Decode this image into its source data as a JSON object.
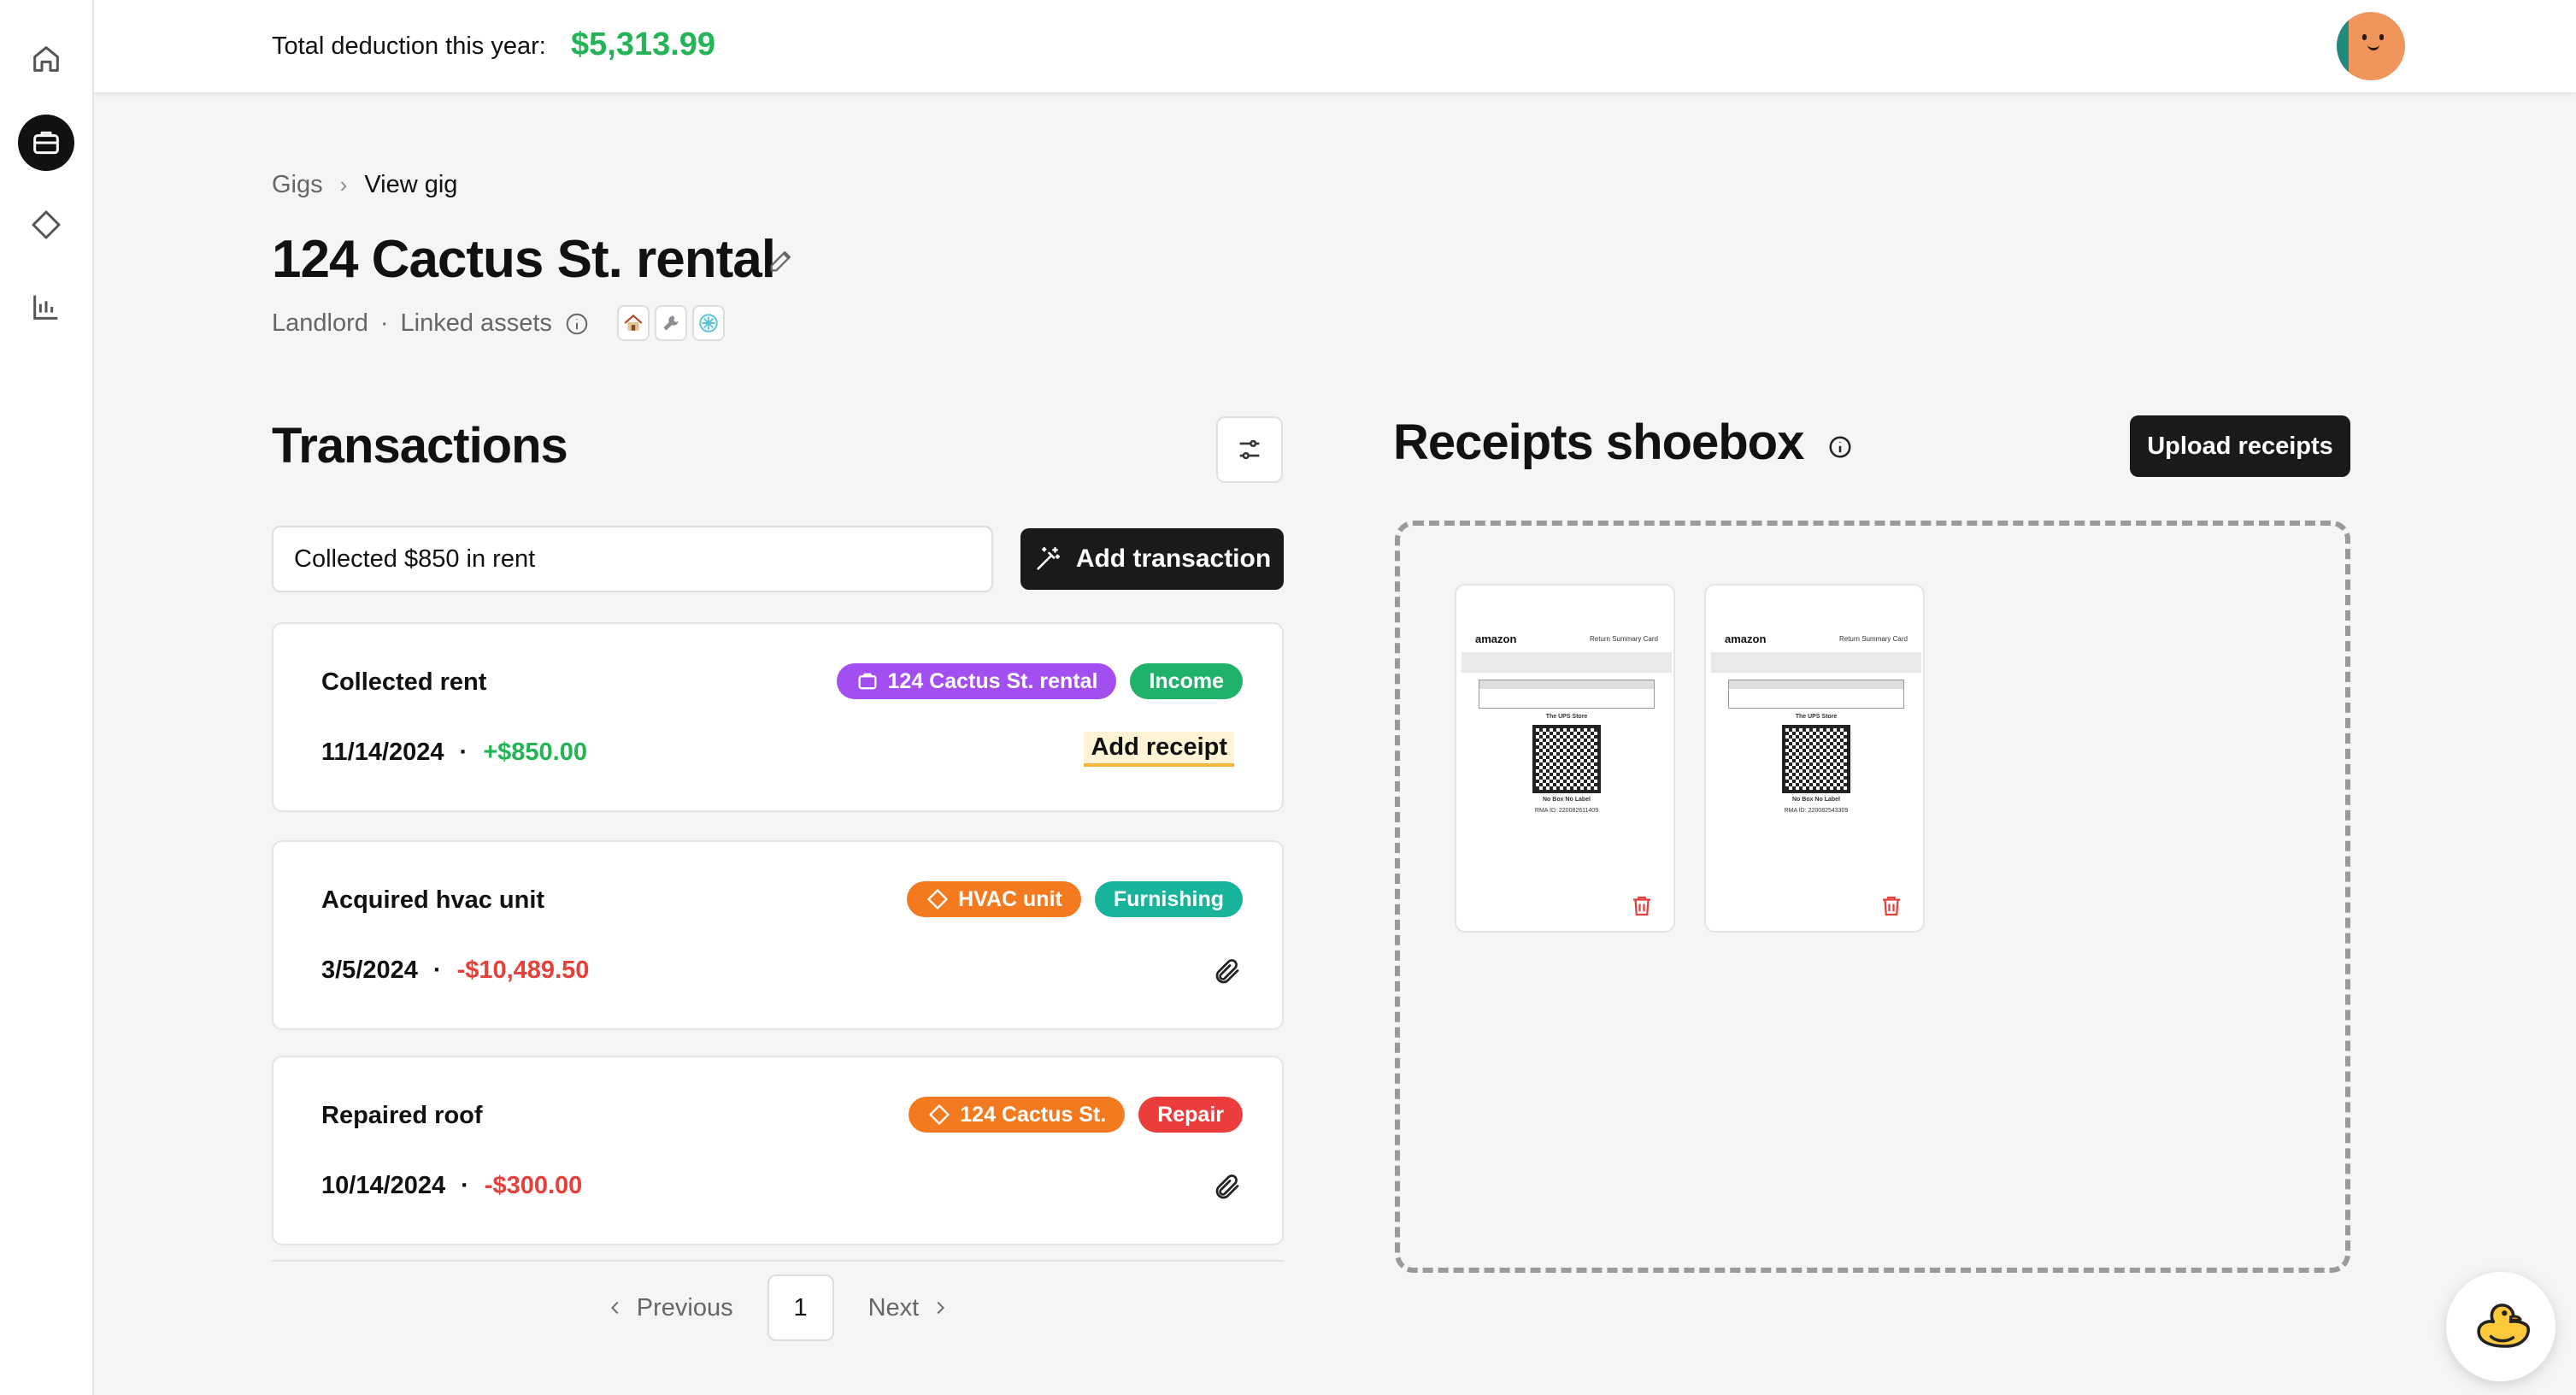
{
  "header": {
    "deduction_label": "Total deduction this year:",
    "deduction_value": "$5,313.99"
  },
  "sidebar": {
    "items": [
      {
        "icon": "home-icon",
        "active": false
      },
      {
        "icon": "briefcase-icon",
        "active": true
      },
      {
        "icon": "diamond-icon",
        "active": false
      },
      {
        "icon": "bar-chart-icon",
        "active": false
      }
    ]
  },
  "breadcrumb": {
    "parent": "Gigs",
    "separator": "›",
    "current": "View gig"
  },
  "gig": {
    "title": "124 Cactus St. rental",
    "role": "Landlord",
    "dot": "·",
    "linked_assets_label": "Linked assets",
    "asset_icons": [
      "house-icon",
      "wrench-icon",
      "snowflake-icon"
    ]
  },
  "transactions": {
    "title": "Transactions",
    "input_value": "Collected $850 in rent",
    "add_button": "Add transaction",
    "items": [
      {
        "name": "Collected rent",
        "date": "11/14/2024",
        "amount": "+$850.00",
        "amount_type": "positive",
        "tags": [
          {
            "label": "124 Cactus St. rental",
            "color": "#a24ef0",
            "icon": "briefcase-icon"
          },
          {
            "label": "Income",
            "color": "#20b26b"
          }
        ],
        "action": "Add receipt"
      },
      {
        "name": "Acquired hvac unit",
        "date": "3/5/2024",
        "amount": "-$10,489.50",
        "amount_type": "negative",
        "tags": [
          {
            "label": "HVAC unit",
            "color": "#f47a1f",
            "icon": "diamond-icon"
          },
          {
            "label": "Furnishing",
            "color": "#17b39a"
          }
        ],
        "action_icon": "paperclip-icon"
      },
      {
        "name": "Repaired roof",
        "date": "10/14/2024",
        "amount": "-$300.00",
        "amount_type": "negative",
        "tags": [
          {
            "label": "124 Cactus St.",
            "color": "#f47a1f",
            "icon": "diamond-icon"
          },
          {
            "label": "Repair",
            "color": "#ec3d3d"
          }
        ],
        "action_icon": "paperclip-icon"
      }
    ]
  },
  "pagination": {
    "previous": "Previous",
    "current_page": "1",
    "next": "Next"
  },
  "receipts": {
    "title": "Receipts shoebox",
    "upload_button": "Upload receipts",
    "items": [
      {
        "brand": "amazon",
        "doc_title": "Return Summary Card",
        "store": "The UPS Store",
        "label": "No Box No Label",
        "rma": "RMA ID: 220082611409"
      },
      {
        "brand": "amazon",
        "doc_title": "Return Summary Card",
        "store": "The UPS Store",
        "label": "No Box No Label",
        "rma": "RMA ID: 220082543309"
      }
    ]
  },
  "colors": {
    "positive": "#22b455",
    "negative": "#e5403a",
    "accent_dark": "#1a1a1a"
  }
}
